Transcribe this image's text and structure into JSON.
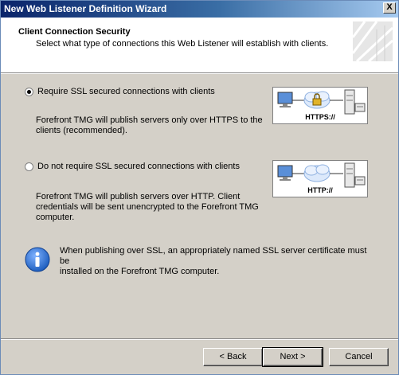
{
  "window": {
    "title": "New Web Listener Definition Wizard",
    "close_label": "X"
  },
  "header": {
    "title": "Client Connection Security",
    "subtitle": "Select what type of connections this Web Listener will establish with clients."
  },
  "options": [
    {
      "label": "Require SSL secured connections with clients",
      "selected": true,
      "description_line1": "Forefront TMG will publish servers only over HTTPS to the",
      "description_line2": "clients (recommended).",
      "protocol": "HTTPS://"
    },
    {
      "label": "Do not require SSL secured connections with clients",
      "selected": false,
      "description_line1": "Forefront TMG will publish servers over HTTP. Client",
      "description_line2": "credentials will be sent unencrypted to the Forefront TMG",
      "description_line3": "computer.",
      "protocol": "HTTP://"
    }
  ],
  "info": {
    "line1": "When publishing over SSL, an appropriately named SSL server certificate must be",
    "line2": "installed on the Forefront TMG computer."
  },
  "buttons": {
    "back": "< Back",
    "next": "Next >",
    "cancel": "Cancel"
  },
  "colors": {
    "titlebar_start": "#0a246a",
    "titlebar_end": "#a6caf0",
    "dialog_bg": "#d4d0c8",
    "info_blue": "#1f5fbf"
  }
}
